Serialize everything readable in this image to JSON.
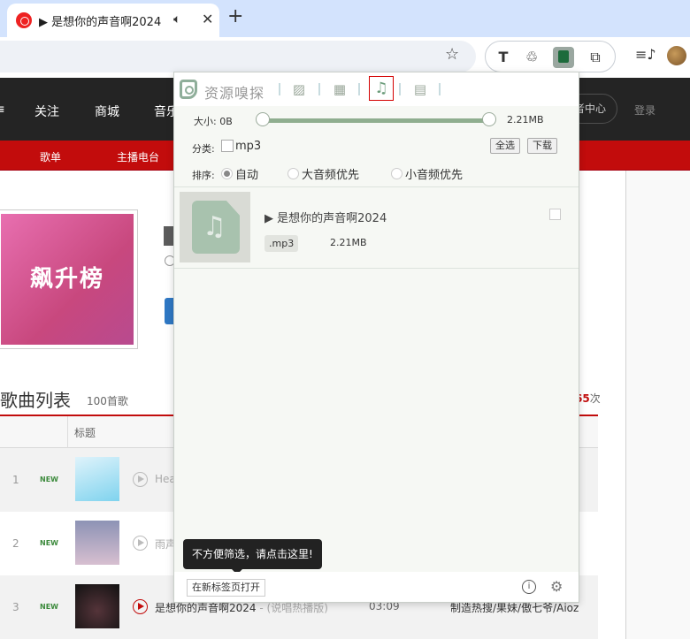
{
  "browser": {
    "tab_title": "▶ 是想你的声音啊2024",
    "tab_audio_icon": "speaker-icon",
    "tab_close": "✕",
    "new_tab": "+",
    "star": "☆",
    "ext_icons": [
      "T",
      "♲",
      "",
      "⧉"
    ],
    "media_icon": "≡♪"
  },
  "page": {
    "nav": [
      "关注",
      "商城",
      "音乐"
    ],
    "creator_center": "者中心",
    "login": "登录",
    "subnav": [
      "歌单",
      "主播电台"
    ],
    "cover_text": "飙升榜",
    "list_title": "歌曲列表",
    "list_count": "100首歌",
    "play_count_num": "65",
    "play_count_unit": "次",
    "table_header_title": "标题",
    "rows": [
      {
        "rank": "1",
        "tag": "NEW",
        "title": "Hea",
        "sub": "",
        "duration": "",
        "artist": ""
      },
      {
        "rank": "2",
        "tag": "NEW",
        "title": "雨声",
        "sub": "",
        "duration": "",
        "artist": ""
      },
      {
        "rank": "3",
        "tag": "NEW",
        "title": "是想你的声音啊2024",
        "sub": " - (说唱热播版)",
        "duration": "03:09",
        "artist": "制造热搜/果妹/傲七爷/Aioz"
      }
    ]
  },
  "popup": {
    "title": "资源嗅探",
    "tabs": [
      "image-icon",
      "video-icon",
      "music-icon",
      "document-icon"
    ],
    "size_label": "大小: 0B",
    "size_max": "2.21MB",
    "filter_label": "分类:",
    "filter_mp3": "mp3",
    "select_all": "全选",
    "download": "下载",
    "sort_label": "排序:",
    "sort_options": [
      "自动",
      "大音频优先",
      "小音频优先"
    ],
    "sort_selected": 0,
    "item": {
      "title": "▶ 是想你的声音啊2024",
      "ext": ".mp3",
      "size": "2.21MB"
    },
    "tooltip": "不方便筛选，请点击这里!",
    "open_newtab": "在新标签页打开",
    "info": "i",
    "settings": "⚙"
  }
}
